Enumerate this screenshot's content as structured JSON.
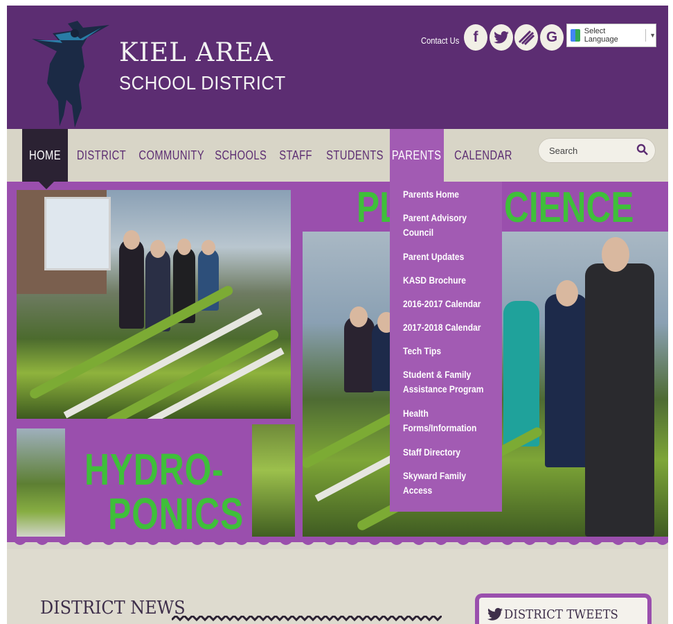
{
  "header": {
    "title_line1": "KIEL AREA",
    "title_line2": "SCHOOL DISTRICT",
    "contact_label": "Contact Us",
    "social_icons": [
      "facebook-icon",
      "twitter-icon",
      "peachjar-icon",
      "google-icon"
    ],
    "social_glyphs": [
      "f",
      "",
      "",
      "G"
    ],
    "language_label": "Select Language",
    "language_arrow": "▼"
  },
  "nav": {
    "items": [
      "HOME",
      "DISTRICT",
      "COMMUNITY",
      "SCHOOLS",
      "STAFF",
      "STUDENTS",
      "PARENTS",
      "CALENDAR"
    ],
    "active": "HOME",
    "open_menu": "PARENTS",
    "search_placeholder": "Search"
  },
  "parents_menu": {
    "items": [
      "Parents Home",
      "Parent Advisory Council",
      "Parent Updates",
      "KASD Brochure",
      "2016-2017 Calendar",
      "2017-2018 Calendar",
      "Tech Tips",
      "Student & Family Assistance Program",
      "Health Forms/Information",
      "Staff Directory",
      "Skyward Family Access"
    ]
  },
  "hero": {
    "left_heading_line1": "HYDRO-",
    "left_heading_line2": "PONICS",
    "right_heading_visible_left": "PL",
    "right_heading_visible_right": "CIENCE"
  },
  "news": {
    "title": "DISTRICT NEWS"
  },
  "tweets": {
    "title": "DISTRICT TWEETS"
  },
  "colors": {
    "brand_purple": "#5c2d72",
    "menu_purple": "#a25bb3",
    "hero_purple": "#9a4fad",
    "nav_bg": "#d8d5c7",
    "accent_green": "#3fbf3a"
  }
}
